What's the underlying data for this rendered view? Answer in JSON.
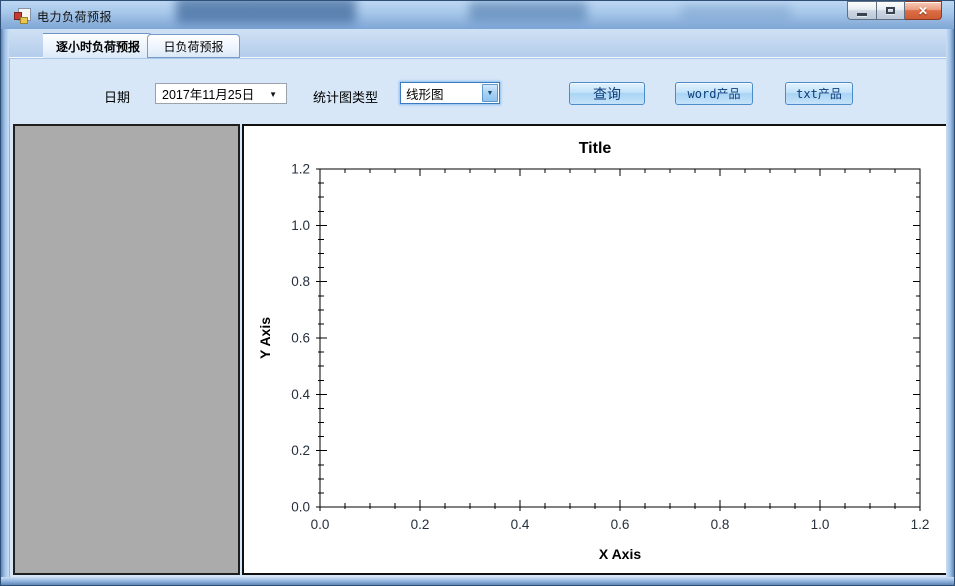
{
  "window": {
    "title": "电力负荷预报",
    "minimize_label": "minimize",
    "maximize_label": "maximize",
    "close_label": "close",
    "close_glyph": "✕"
  },
  "tabs": {
    "hourly": {
      "label": "逐小时负荷预报",
      "selected": true
    },
    "daily": {
      "label": "日负荷预报",
      "selected": false
    }
  },
  "toolbar": {
    "date_label": "日期",
    "date_value": "2017年11月25日",
    "dropdown_arrow": "▼",
    "chart_type_label": "统计图类型",
    "chart_type_value": "线形图",
    "query_label": "查询",
    "word_label": "word产品",
    "txt_label": "txt产品"
  },
  "chart_data": {
    "type": "line",
    "title": "Title",
    "xlabel": "X Axis",
    "ylabel": "Y Axis",
    "xlim": [
      0.0,
      1.2
    ],
    "ylim": [
      0.0,
      1.2
    ],
    "x_major_step": 0.2,
    "x_minor_step": 0.05,
    "y_major_step": 0.2,
    "y_minor_step": 0.05,
    "x_tick_labels": [
      "0.0",
      "0.2",
      "0.4",
      "0.6",
      "0.8",
      "1.0",
      "1.2"
    ],
    "y_tick_labels": [
      "0.0",
      "0.2",
      "0.4",
      "0.6",
      "0.8",
      "1.0",
      "1.2"
    ],
    "series": [],
    "grid": false,
    "legend": false
  },
  "colors": {
    "titlebar_top": "#bdd7f2",
    "titlebar_bottom": "#7fa7d7",
    "accent_border": "#4c8ac8",
    "button_text": "#0d3d7a",
    "tab_page_bg": "#d8e7f8",
    "gray_panel": "#ababab",
    "chart_bg": "#ffffff",
    "axis_color": "#000000",
    "tick_label_color": "#26303d",
    "chart_title_color": "#000000"
  }
}
